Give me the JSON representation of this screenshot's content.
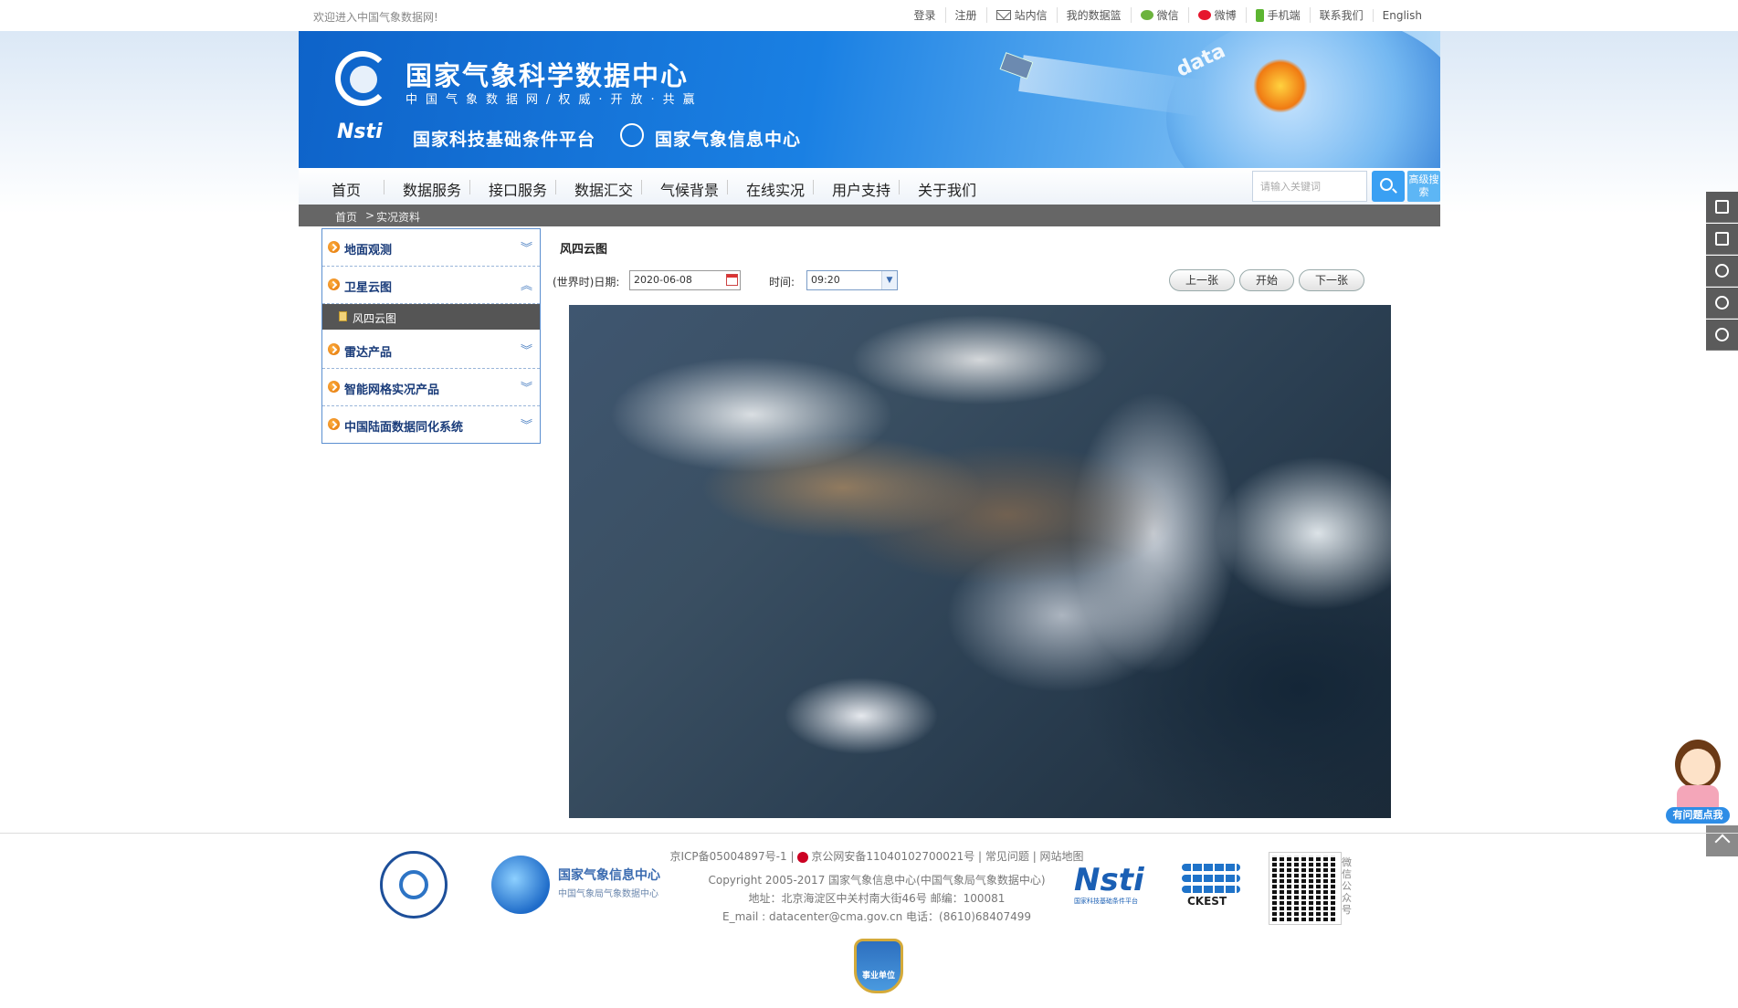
{
  "topbar": {
    "welcome": "欢迎进入中国气象数据网!",
    "links": [
      "登录",
      "注册",
      "站内信",
      "我的数据篮",
      "微信",
      "微博",
      "手机端",
      "联系我们",
      "English"
    ]
  },
  "banner": {
    "title": "国家气象科学数据中心",
    "subtitle": "中国气象数据网/权威·开放·共赢",
    "nsti_logo": "Nsti",
    "platform": "国家科技基础条件平台",
    "center": "国家气象信息中心",
    "data_word": "data"
  },
  "nav": {
    "items": [
      "首页",
      "数据服务",
      "接口服务",
      "数据汇交",
      "气候背景",
      "在线实况",
      "用户支持",
      "关于我们"
    ],
    "search_placeholder": "请输入关键词",
    "advanced_search": "高级搜索"
  },
  "breadcrumb": {
    "home": "首页",
    "sep": ">",
    "current": "实况资料"
  },
  "sidebar": {
    "items": [
      "地面观测",
      "卫星云图",
      "雷达产品",
      "智能网格实况产品",
      "中国陆面数据同化系统"
    ],
    "sub_item": "风四云图"
  },
  "main": {
    "title": "风四云图",
    "date_label": "(世界时)日期:",
    "date_value": "2020-06-08",
    "time_label": "时间:",
    "time_value": "09:20",
    "prev": "上一张",
    "start": "开始",
    "next": "下一张"
  },
  "helper": {
    "label": "有问题点我"
  },
  "footer": {
    "icp": "京ICP备05004897号-1 |",
    "police": "京公网安备11040102700021号 | 常见问题 | 网站地图",
    "copyright": "Copyright 2005-2017 国家气象信息中心(中国气象局气象数据中心)",
    "address": "地址：北京海淀区中关村南大街46号 邮编：100081",
    "contact": "E_mail : datacenter@cma.gov.cn 电话：(8610)68407499",
    "nmic_name": "国家气象信息中心",
    "nmic_sub": "中国气象局气象数据中心",
    "nsti": "Nsti",
    "nsti_sub": "国家科技基础条件平台",
    "ckest": "CKEST",
    "wechat_label": "微信公众号",
    "badge": "事业单位"
  }
}
